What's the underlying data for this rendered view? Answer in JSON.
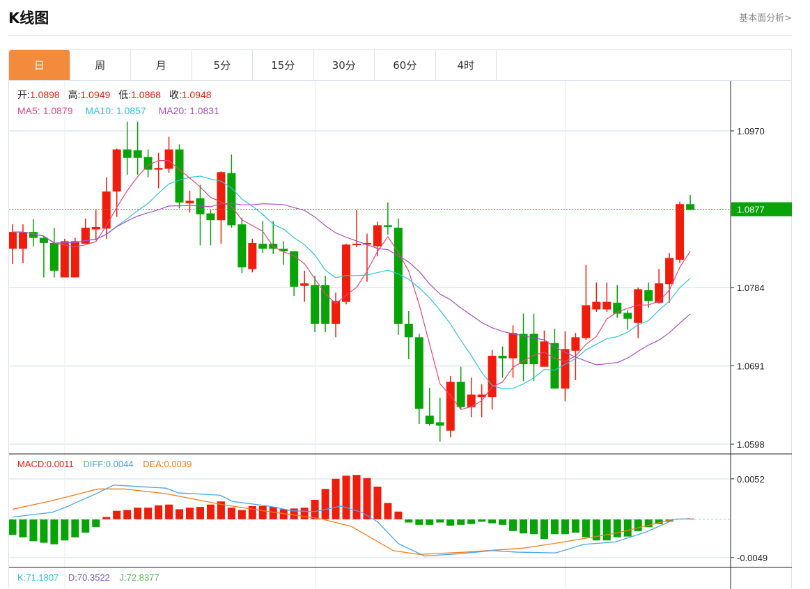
{
  "header": {
    "title": "K线图",
    "link": "基本面分析>"
  },
  "tabs": [
    {
      "label": "日",
      "active": true
    },
    {
      "label": "周"
    },
    {
      "label": "月"
    },
    {
      "label": "5分"
    },
    {
      "label": "15分"
    },
    {
      "label": "30分"
    },
    {
      "label": "60分"
    },
    {
      "label": "4时"
    }
  ],
  "info": {
    "open_label": "开:",
    "open": "1.0898",
    "high_label": "高:",
    "high": "1.0949",
    "low_label": "低:",
    "low": "1.0868",
    "close_label": "收:",
    "close": "1.0948",
    "ma5_label": "MA5:",
    "ma5": "1.0879",
    "ma10_label": "MA10:",
    "ma10": "1.0857",
    "ma20_label": "MA20:",
    "ma20": "1.0831"
  },
  "macd_info": {
    "macd": "MACD:0.0011",
    "diff": "DIFF:0.0044",
    "dea": "DEA:0.0039"
  },
  "kdj_info": {
    "k": "K:71.1807",
    "d": "D:70.3522",
    "j": "J:72.8377"
  },
  "colors": {
    "up": "#f01c0c",
    "down": "#07a307",
    "ma5": "#e8467c",
    "ma10": "#2bc4de",
    "ma20": "#aa4ec4",
    "diff": "#4aa3f0",
    "dea": "#f57c1c",
    "accent": "#f28c3c"
  },
  "chart_data": {
    "type": "candlestick",
    "price_ticks": [
      "1.0970",
      "1.0784",
      "1.0691",
      "1.0598"
    ],
    "price_tick_values": [
      1.097,
      1.0784,
      1.0691,
      1.0598
    ],
    "last_price": "1.0877",
    "last_price_value": 1.0877,
    "macd_ticks": [
      "0.0052",
      "-0.0049"
    ],
    "macd_tick_values": [
      0.0052,
      -0.0049
    ],
    "candles": [
      [
        1.083,
        1.0859,
        1.0812,
        1.085
      ],
      [
        1.083,
        1.0859,
        1.0813,
        1.085
      ],
      [
        1.085,
        1.0865,
        1.0833,
        1.0843
      ],
      [
        1.0843,
        1.0845,
        1.0796,
        1.0837
      ],
      [
        1.0837,
        1.0855,
        1.0796,
        1.0804
      ],
      [
        1.0796,
        1.0842,
        1.0796,
        1.0839
      ],
      [
        1.0796,
        1.0843,
        1.0796,
        1.0839
      ],
      [
        1.0836,
        1.0866,
        1.0836,
        1.0855
      ],
      [
        1.0853,
        1.0876,
        1.084,
        1.0856
      ],
      [
        1.0854,
        1.0915,
        1.0842,
        1.0898
      ],
      [
        1.0898,
        1.0949,
        1.0868,
        1.0948
      ],
      [
        1.0948,
        1.0981,
        1.0918,
        1.0938
      ],
      [
        1.0947,
        1.0981,
        1.0918,
        1.0938
      ],
      [
        1.0939,
        1.0948,
        1.0915,
        1.0924
      ],
      [
        1.0924,
        1.0944,
        1.0902,
        1.0926
      ],
      [
        1.0925,
        1.0963,
        1.092,
        1.0948
      ],
      [
        1.0948,
        1.0954,
        1.0878,
        1.0885
      ],
      [
        1.0884,
        1.0899,
        1.0873,
        1.0887
      ],
      [
        1.089,
        1.0906,
        1.0834,
        1.0871
      ],
      [
        1.0872,
        1.0876,
        1.0834,
        1.0864
      ],
      [
        1.0864,
        1.0922,
        1.0836,
        1.0921
      ],
      [
        1.092,
        1.0942,
        1.0855,
        1.0858
      ],
      [
        1.0859,
        1.0867,
        1.0801,
        1.0808
      ],
      [
        1.0806,
        1.0842,
        1.0802,
        1.0837
      ],
      [
        1.0836,
        1.0863,
        1.0825,
        1.083
      ],
      [
        1.0836,
        1.0863,
        1.0824,
        1.083
      ],
      [
        1.083,
        1.0839,
        1.0811,
        1.0827
      ],
      [
        1.0827,
        1.0827,
        1.0774,
        1.0785
      ],
      [
        1.0786,
        1.0804,
        1.0767,
        1.0789
      ],
      [
        1.0787,
        1.0798,
        1.0731,
        1.0741
      ],
      [
        1.0787,
        1.0798,
        1.0731,
        1.0741
      ],
      [
        1.0741,
        1.0778,
        1.0725,
        1.0768
      ],
      [
        1.0767,
        1.0836,
        1.0764,
        1.0835
      ],
      [
        1.0835,
        1.0876,
        1.0832,
        1.0836
      ],
      [
        1.0835,
        1.0848,
        1.0791,
        1.0837
      ],
      [
        1.0833,
        1.0862,
        1.0821,
        1.0858
      ],
      [
        1.0858,
        1.0885,
        1.0847,
        1.0856
      ],
      [
        1.0855,
        1.0866,
        1.0728,
        1.0741
      ],
      [
        1.0741,
        1.0756,
        1.0699,
        1.0725
      ],
      [
        1.0725,
        1.0729,
        1.0622,
        1.064
      ],
      [
        1.0632,
        1.0665,
        1.062,
        1.0622
      ],
      [
        1.0624,
        1.0653,
        1.0601,
        1.062
      ],
      [
        1.0614,
        1.0679,
        1.0606,
        1.0672
      ],
      [
        1.0672,
        1.069,
        1.064,
        1.0642
      ],
      [
        1.0642,
        1.0677,
        1.063,
        1.0657
      ],
      [
        1.0654,
        1.0669,
        1.063,
        1.0657
      ],
      [
        1.0654,
        1.071,
        1.0639,
        1.0703
      ],
      [
        1.0703,
        1.0714,
        1.0677,
        1.07
      ],
      [
        1.07,
        1.0739,
        1.0677,
        1.073
      ],
      [
        1.0729,
        1.0753,
        1.0673,
        1.0693
      ],
      [
        1.0729,
        1.0753,
        1.0673,
        1.0693
      ],
      [
        1.069,
        1.0733,
        1.069,
        1.072
      ],
      [
        1.0718,
        1.0735,
        1.0664,
        1.0664
      ],
      [
        1.0664,
        1.0732,
        1.0649,
        1.0711
      ],
      [
        1.0709,
        1.073,
        1.0674,
        1.0725
      ],
      [
        1.0724,
        1.0811,
        1.0722,
        1.0763
      ],
      [
        1.0758,
        1.079,
        1.0755,
        1.0767
      ],
      [
        1.0758,
        1.079,
        1.0755,
        1.0767
      ],
      [
        1.0766,
        1.0787,
        1.0748,
        1.0753
      ],
      [
        1.0754,
        1.0757,
        1.0734,
        1.0747
      ],
      [
        1.0742,
        1.0784,
        1.0724,
        1.0782
      ],
      [
        1.0781,
        1.079,
        1.076,
        1.0768
      ],
      [
        1.0766,
        1.0806,
        1.0765,
        1.0789
      ],
      [
        1.0788,
        1.0825,
        1.0766,
        1.0819
      ],
      [
        1.0817,
        1.0886,
        1.0813,
        1.0883
      ],
      [
        1.0883,
        1.0894,
        1.0876,
        1.0876
      ]
    ],
    "macd_hist": [
      -0.002,
      -0.0023,
      -0.0028,
      -0.003,
      -0.0032,
      -0.0027,
      -0.0023,
      -0.0017,
      -0.001,
      0.0003,
      0.0011,
      0.0012,
      0.0015,
      0.0015,
      0.0018,
      0.0019,
      0.0013,
      0.0015,
      0.0016,
      0.0019,
      0.0023,
      0.0015,
      0.0012,
      0.0017,
      0.0017,
      0.0016,
      0.0013,
      0.0014,
      0.0015,
      0.0025,
      0.0039,
      0.0052,
      0.0056,
      0.0057,
      0.0053,
      0.0042,
      0.0021,
      0.001,
      -0.0004,
      -0.0007,
      -0.0007,
      -0.0004,
      -0.0008,
      -0.0007,
      -0.0006,
      -0.0003,
      -0.0005,
      -0.0007,
      -0.0015,
      -0.0018,
      -0.0019,
      -0.0025,
      -0.0019,
      -0.0019,
      -0.0017,
      -0.0023,
      -0.0027,
      -0.0027,
      -0.0023,
      -0.0022,
      -0.0015,
      -0.001,
      -0.0006,
      -0.0003,
      0.0001,
      0.0001
    ],
    "diff": [
      [
        0,
        0.0003
      ],
      [
        3.8,
        0.0009
      ],
      [
        5,
        0.0015
      ],
      [
        8.2,
        0.0034
      ],
      [
        9.7,
        0.0044
      ],
      [
        14.7,
        0.004
      ],
      [
        15.9,
        0.0034
      ],
      [
        19.9,
        0.0031
      ],
      [
        21.1,
        0.0023
      ],
      [
        24.6,
        0.0017
      ],
      [
        26.8,
        0.0011
      ],
      [
        29,
        0.001
      ],
      [
        31.5,
        0.0017
      ],
      [
        33.5,
        0.0009
      ],
      [
        35,
        -0.0003
      ],
      [
        37,
        -0.0031
      ],
      [
        39.5,
        -0.0047
      ],
      [
        43,
        -0.0044
      ],
      [
        46,
        -0.004
      ],
      [
        48.4,
        -0.0042
      ],
      [
        52.1,
        -0.0043
      ],
      [
        54.8,
        -0.0032
      ],
      [
        57.8,
        -0.0029
      ],
      [
        60.8,
        -0.0016
      ],
      [
        63.5,
        0.0
      ],
      [
        65,
        0.0001
      ]
    ],
    "dea": [
      [
        0,
        0.0013
      ],
      [
        3.8,
        0.0024
      ],
      [
        8.2,
        0.0039
      ],
      [
        10.7,
        0.0039
      ],
      [
        14.7,
        0.0033
      ],
      [
        20.1,
        0.0019
      ],
      [
        24.6,
        0.001
      ],
      [
        29.5,
        0.0001
      ],
      [
        32.5,
        -0.0009
      ],
      [
        36.5,
        -0.004
      ],
      [
        39,
        -0.0045
      ],
      [
        43.4,
        -0.0042
      ],
      [
        48.9,
        -0.0037
      ],
      [
        51.9,
        -0.0031
      ],
      [
        57.8,
        -0.0018
      ],
      [
        63.3,
        0.0
      ],
      [
        65,
        0.0001
      ]
    ]
  }
}
